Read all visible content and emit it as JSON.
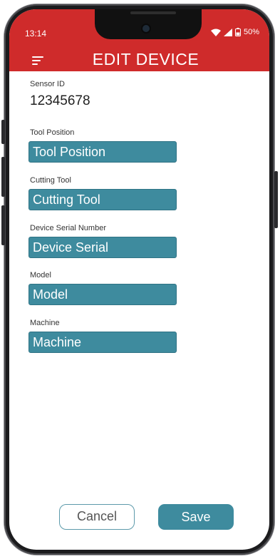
{
  "status_bar": {
    "time": "13:14",
    "battery": "50%",
    "icons": [
      "wifi-icon",
      "signal-icon",
      "battery-icon"
    ]
  },
  "header": {
    "title": "EDIT DEVICE",
    "menu_icon": "hamburger-menu-icon",
    "color": "#cf2b2b"
  },
  "form": {
    "sensor_id": {
      "label": "Sensor ID",
      "value": "12345678"
    },
    "tool_position": {
      "label": "Tool Position",
      "value": "Tool Position"
    },
    "cutting_tool": {
      "label": "Cutting Tool",
      "value": "Cutting Tool"
    },
    "device_serial": {
      "label": "Device Serial Number",
      "value": "Device Serial"
    },
    "model": {
      "label": "Model",
      "value": "Model"
    },
    "machine": {
      "label": "Machine",
      "value": "Machine"
    },
    "field_color": "#3e8b9e"
  },
  "actions": {
    "cancel_label": "Cancel",
    "save_label": "Save"
  }
}
